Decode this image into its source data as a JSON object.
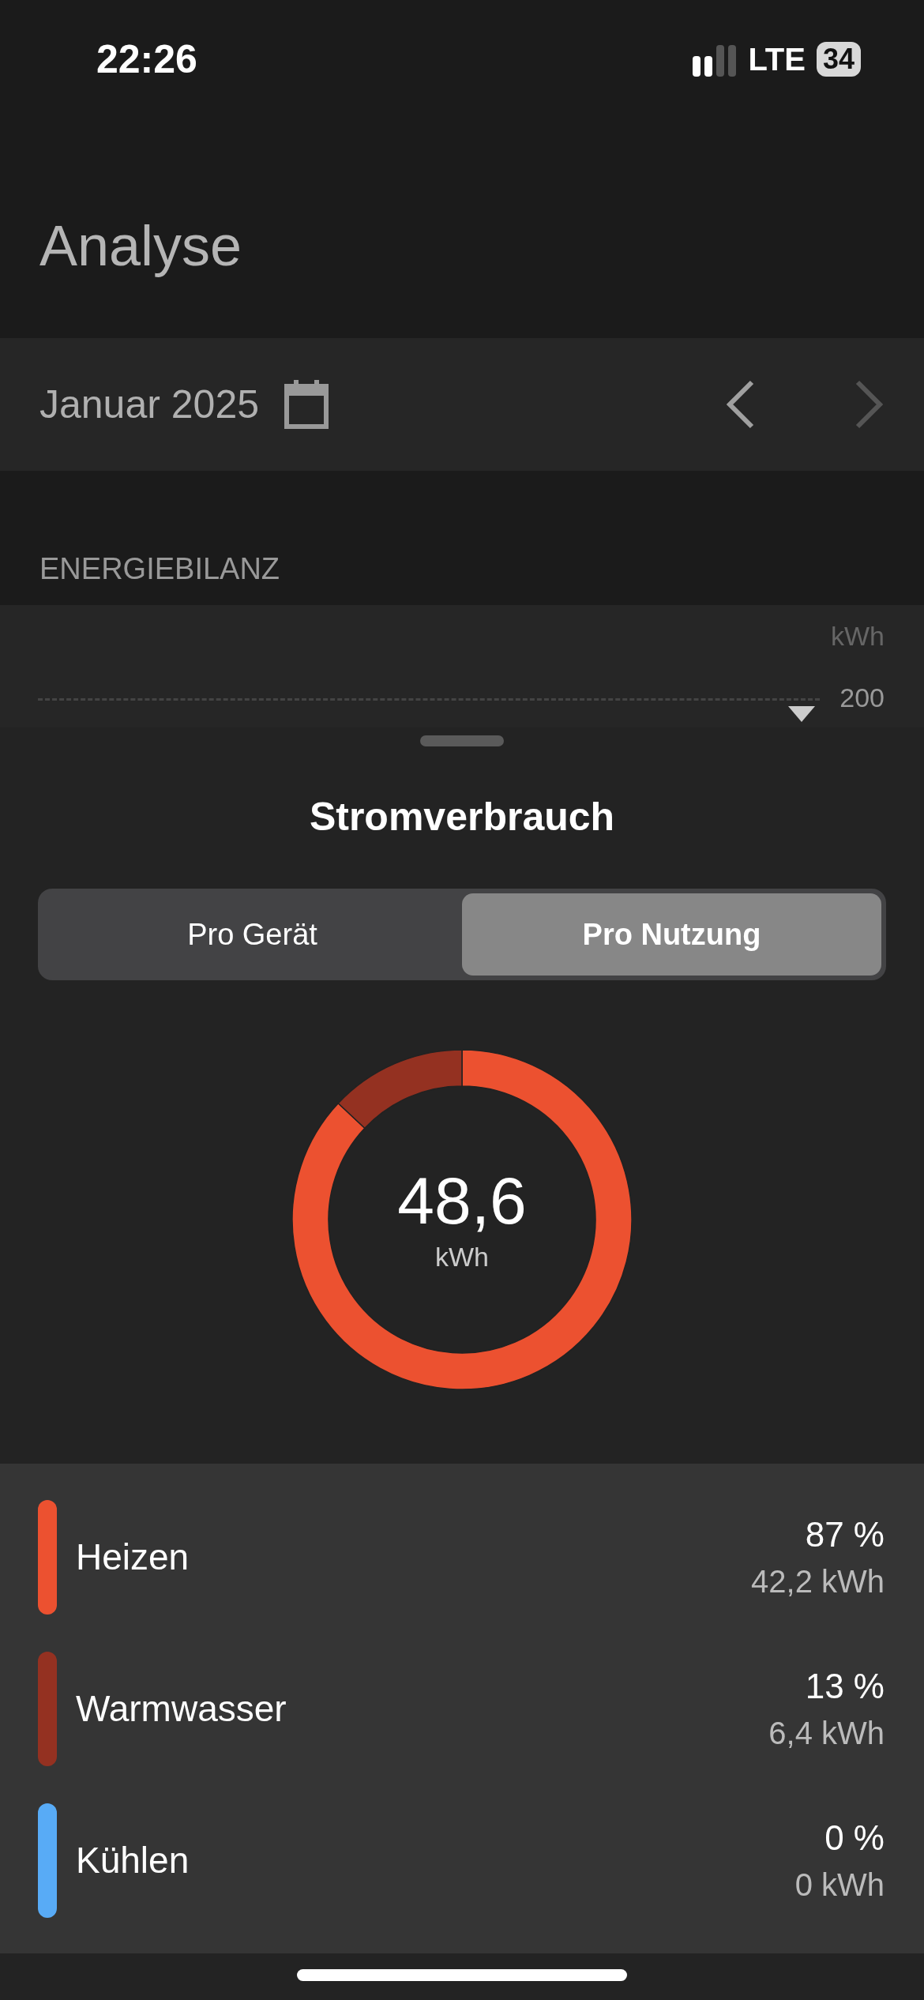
{
  "status_bar": {
    "time": "22:26",
    "network": "LTE",
    "battery": "34"
  },
  "title": "Analyse",
  "period": {
    "label": "Januar 2025",
    "prev_enabled": true,
    "next_enabled": false
  },
  "section_label": "ENERGIEBILANZ",
  "balance_chart": {
    "unit": "kWh",
    "tick": "200"
  },
  "sheet": {
    "title": "Stromverbrauch",
    "tabs": [
      {
        "label": "Pro Gerät",
        "selected": false
      },
      {
        "label": "Pro Nutzung",
        "selected": true
      }
    ],
    "total": {
      "value": "48,6",
      "unit": "kWh"
    },
    "chart_data": {
      "type": "donut",
      "categories": [
        "Heizen",
        "Warmwasser",
        "Kühlen"
      ],
      "values": [
        87,
        13,
        0
      ]
    },
    "legend": [
      {
        "percent": "87 %",
        "energy": "42,2 kWh",
        "color": "#ec5130"
      },
      {
        "percent": "13 %",
        "energy": "6,4 kWh",
        "color": "#943121"
      },
      {
        "percent": "0 %",
        "energy": "0 kWh",
        "color": "#58abf6"
      }
    ]
  }
}
